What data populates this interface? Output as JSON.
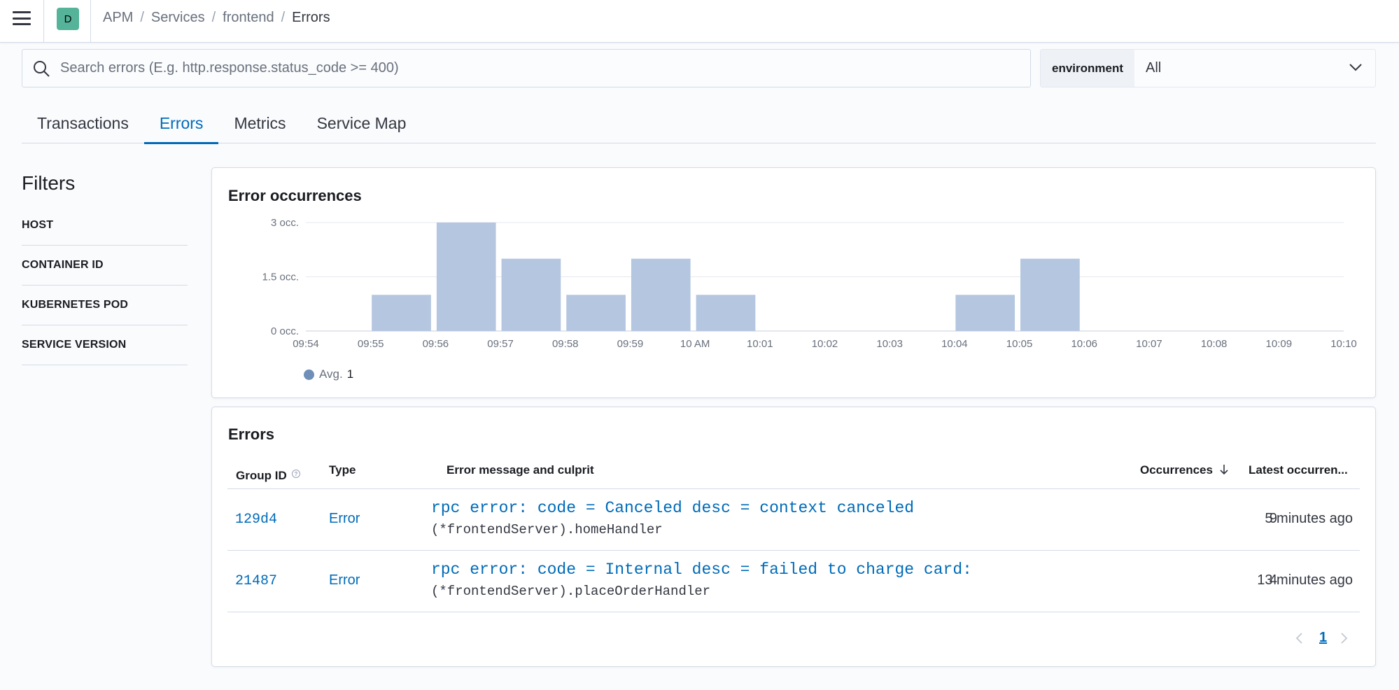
{
  "header": {
    "space_initial": "D",
    "breadcrumbs": [
      "APM",
      "Services",
      "frontend",
      "Errors"
    ]
  },
  "search": {
    "placeholder": "Search errors (E.g. http.response.status_code >= 400)",
    "value": ""
  },
  "environment": {
    "label": "environment",
    "selected": "All"
  },
  "tabs": [
    {
      "label": "Transactions",
      "active": false
    },
    {
      "label": "Errors",
      "active": true
    },
    {
      "label": "Metrics",
      "active": false
    },
    {
      "label": "Service Map",
      "active": false
    }
  ],
  "filters": {
    "title": "Filters",
    "items": [
      "HOST",
      "CONTAINER ID",
      "KUBERNETES POD",
      "SERVICE VERSION"
    ]
  },
  "occurrences_panel": {
    "title": "Error occurrences",
    "legend_label": "Avg.",
    "legend_value": "1"
  },
  "chart_data": {
    "type": "bar",
    "title": "Error occurrences",
    "x_ticks": [
      "09:54",
      "09:55",
      "09:56",
      "09:57",
      "09:58",
      "09:59",
      "10 AM",
      "10:01",
      "10:02",
      "10:03",
      "10:04",
      "10:05",
      "10:06",
      "10:07",
      "10:08",
      "10:09",
      "10:10"
    ],
    "y_ticks": [
      "0 occ.",
      "1.5 occ.",
      "3 occ."
    ],
    "ylim": [
      0,
      3
    ],
    "bars": [
      {
        "start": "09:55",
        "value": 1
      },
      {
        "start": "09:56",
        "value": 3
      },
      {
        "start": "09:57",
        "value": 2
      },
      {
        "start": "09:58",
        "value": 1
      },
      {
        "start": "09:59",
        "value": 2
      },
      {
        "start": "10 AM",
        "value": 1
      },
      {
        "start": "10:04",
        "value": 1
      },
      {
        "start": "10:05",
        "value": 2
      }
    ],
    "grid": true,
    "bar_color": "#b4c6e0",
    "legend": "bottom-left"
  },
  "errors_panel": {
    "title": "Errors",
    "columns": [
      "Group ID",
      "Type",
      "Error message and culprit",
      "Occurrences",
      "Latest occurren..."
    ],
    "rows": [
      {
        "group_id": "129d4",
        "type": "Error",
        "message": "rpc error: code = Canceled desc = context canceled",
        "culprit": "(*frontendServer).homeHandler",
        "occurrences": "9",
        "latest": "5 minutes ago"
      },
      {
        "group_id": "21487",
        "type": "Error",
        "message": "rpc error: code = Internal desc = failed to charge card: could not charge the card",
        "culprit": "(*frontendServer).placeOrderHandler",
        "occurrences": "4",
        "latest": "13 minutes ago"
      }
    ],
    "page": "1"
  },
  "colors": {
    "accent": "#006bb8",
    "bar": "#b4c6e0",
    "legend_dot": "#6f8fb8",
    "space_avatar": "#54b399"
  }
}
